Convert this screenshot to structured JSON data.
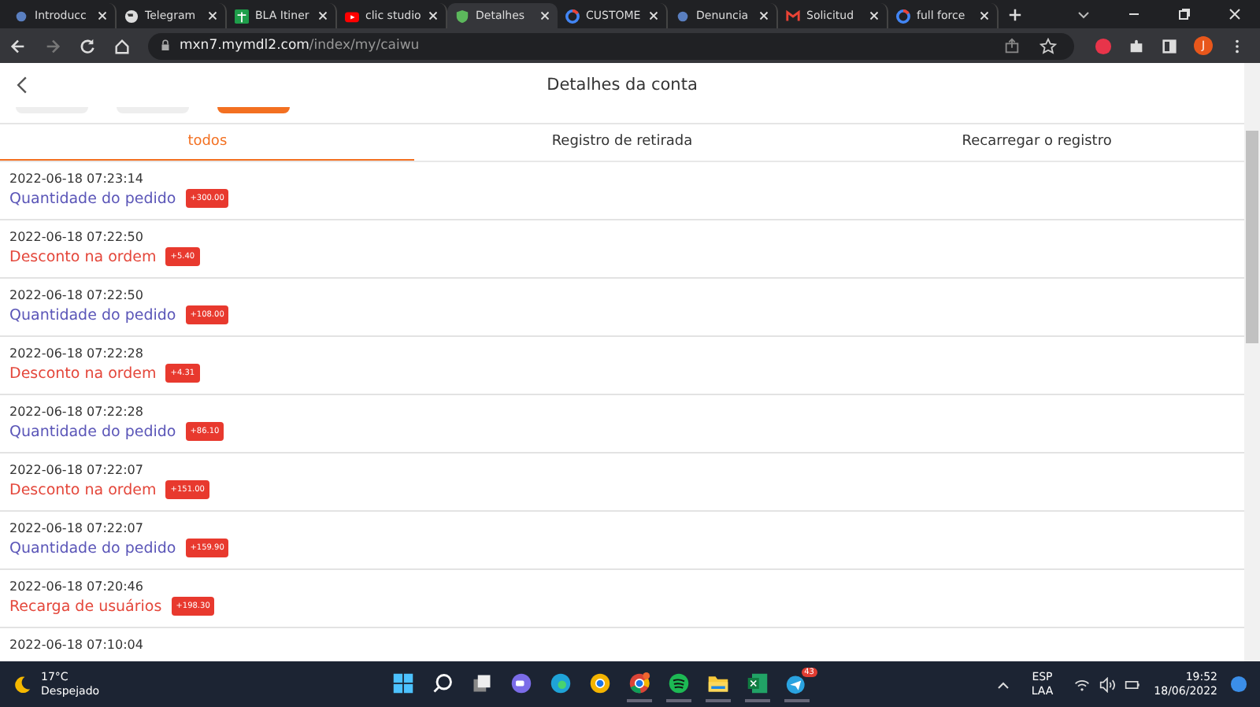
{
  "browser_tabs": [
    {
      "title": "Introducc",
      "selected": false
    },
    {
      "title": "Telegram",
      "selected": false
    },
    {
      "title": "BLA Itiner",
      "selected": false
    },
    {
      "title": "clic studio",
      "selected": false
    },
    {
      "title": "Detalhes",
      "selected": true
    },
    {
      "title": "CUSTOME",
      "selected": false
    },
    {
      "title": "Denuncia",
      "selected": false
    },
    {
      "title": "Solicitud",
      "selected": false
    },
    {
      "title": "full force",
      "selected": false
    }
  ],
  "address": {
    "host": "mxn7.mymdl2.com",
    "path": "/index/my/caiwu"
  },
  "profile_initial": "J",
  "page": {
    "title": "Detalhes da conta",
    "filter_pills": [
      {
        "selected": false
      },
      {
        "selected": false
      },
      {
        "selected": true
      }
    ],
    "tabs": [
      {
        "label": "todos",
        "selected": true
      },
      {
        "label": "Registro de retirada",
        "selected": false
      },
      {
        "label": "Recarregar o registro",
        "selected": false
      }
    ],
    "records": [
      {
        "time": "2022-06-18 07:23:14",
        "label": "Quantidade do pedido",
        "kind": "order",
        "amount": "+300.00"
      },
      {
        "time": "2022-06-18 07:22:50",
        "label": "Desconto na ordem",
        "kind": "discount",
        "amount": "+5.40"
      },
      {
        "time": "2022-06-18 07:22:50",
        "label": "Quantidade do pedido",
        "kind": "order",
        "amount": "+108.00"
      },
      {
        "time": "2022-06-18 07:22:28",
        "label": "Desconto na ordem",
        "kind": "discount",
        "amount": "+4.31"
      },
      {
        "time": "2022-06-18 07:22:28",
        "label": "Quantidade do pedido",
        "kind": "order",
        "amount": "+86.10"
      },
      {
        "time": "2022-06-18 07:22:07",
        "label": "Desconto na ordem",
        "kind": "discount",
        "amount": "+151.00"
      },
      {
        "time": "2022-06-18 07:22:07",
        "label": "Quantidade do pedido",
        "kind": "order",
        "amount": "+159.90"
      },
      {
        "time": "2022-06-18 07:20:46",
        "label": "Recarga de usuários",
        "kind": "recharge",
        "amount": "+198.30"
      },
      {
        "time": "2022-06-18 07:10:04"
      }
    ]
  },
  "taskbar": {
    "weather": {
      "temp": "17°C",
      "condition": "Despejado"
    },
    "telegram_badge": "43",
    "language": "ESP",
    "layout": "LAA",
    "time": "19:52",
    "date": "18/06/2022"
  }
}
